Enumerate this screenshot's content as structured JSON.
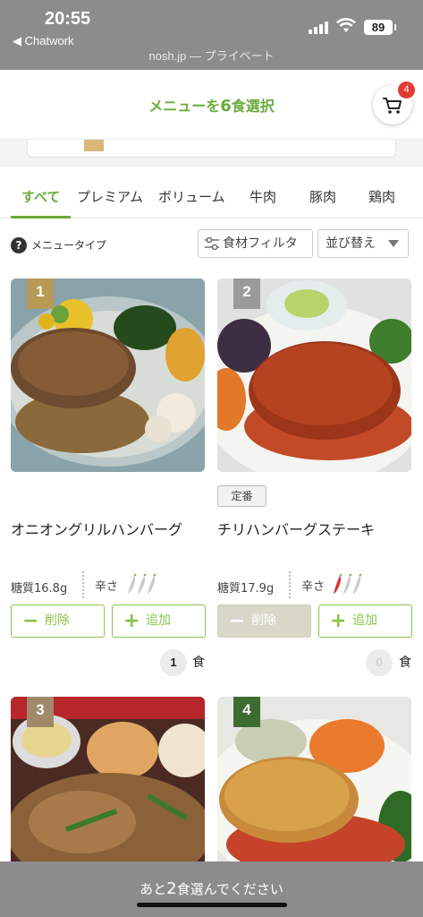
{
  "status_bar": {
    "time": "20:55",
    "back_app": "◀ Chatwork",
    "battery": "89",
    "url": "nosh.jp — プライベート"
  },
  "header": {
    "title_prefix": "メニューを",
    "title_number": "6",
    "title_suffix": "食選択",
    "cart_icon": "cart-icon",
    "cart_count": "4",
    "accent_color": "#6bab3c",
    "badge_color": "#e03c31"
  },
  "tabs": [
    {
      "label": "すべて",
      "active": true
    },
    {
      "label": "プレミアム",
      "active": false
    },
    {
      "label": "ボリューム",
      "active": false
    },
    {
      "label": "牛肉",
      "active": false
    },
    {
      "label": "豚肉",
      "active": false
    },
    {
      "label": "鶏肉",
      "active": false
    }
  ],
  "filters": {
    "help_icon": "?",
    "menu_type_label": "メニュータイプ",
    "ingredient_filter_label": "食材フィルタ",
    "sort_label": "並び替え"
  },
  "products": [
    {
      "rank": "1",
      "rank_color": "#b89a55",
      "tag": "",
      "name": "オニオングリルハンバーグ",
      "carb": "糖質16.8g",
      "spice_label": "辛さ",
      "spice_level": 0,
      "spice_max": 3,
      "remove_label": "削除",
      "add_label": "追加",
      "remove_enabled": true,
      "quantity": "1",
      "unit": "食"
    },
    {
      "rank": "2",
      "rank_color": "#9a9a9a",
      "tag": "定番",
      "name": "チリハンバーグステーキ",
      "carb": "糖質17.9g",
      "spice_label": "辛さ",
      "spice_level": 1,
      "spice_max": 3,
      "remove_label": "削除",
      "add_label": "追加",
      "remove_enabled": false,
      "quantity": "0",
      "unit": "食"
    },
    {
      "rank": "3",
      "rank_color": "#a08a6a"
    },
    {
      "rank": "4",
      "rank_color": "#3e6b2f"
    }
  ],
  "bottom_bar": {
    "prefix": "あと",
    "number": "2",
    "suffix": "食選んでください"
  }
}
